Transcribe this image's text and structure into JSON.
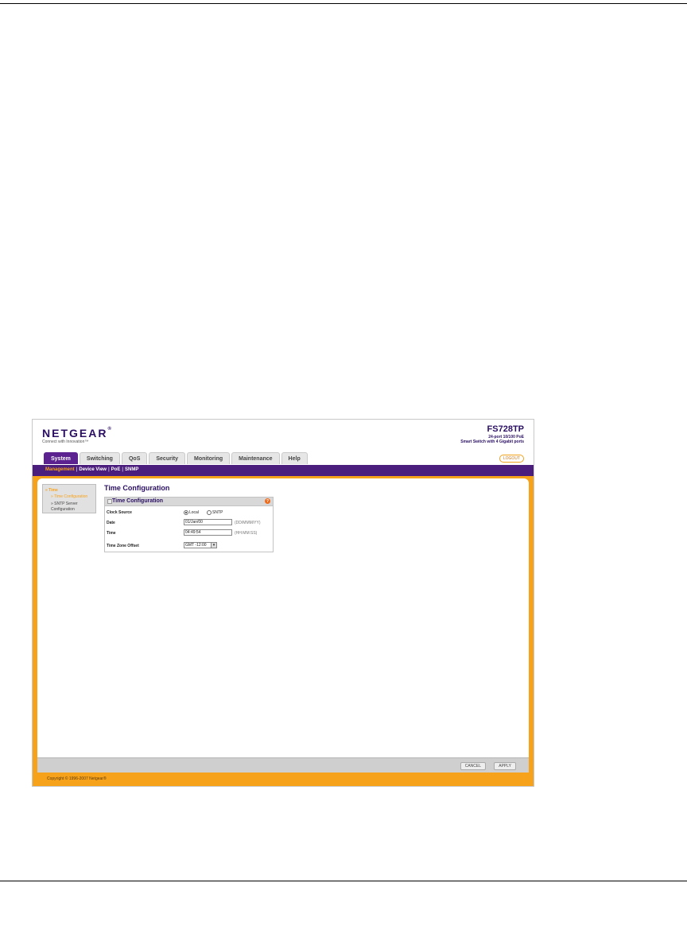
{
  "app": {
    "brand": "NETGEAR",
    "brand_mark": "®",
    "tagline": "Connect with Innovation™",
    "model": "FS728TP",
    "model_desc_1": "24-port 10/100 PoE",
    "model_desc_2": "Smart Switch with 4 Gigabit ports",
    "logout": "LOGOUT"
  },
  "tabs": [
    {
      "label": "System",
      "active": true
    },
    {
      "label": "Switching"
    },
    {
      "label": "QoS"
    },
    {
      "label": "Security"
    },
    {
      "label": "Monitoring"
    },
    {
      "label": "Maintenance"
    },
    {
      "label": "Help"
    }
  ],
  "subnav": [
    {
      "label": "Management",
      "active": true
    },
    {
      "label": "Device View"
    },
    {
      "label": "PoE"
    },
    {
      "label": "SNMP"
    }
  ],
  "subnav_separator": "|",
  "leftnav": {
    "section": "» Time",
    "item_active": "» Time Configuration",
    "item_2": "» SNTP Server Configuration"
  },
  "page": {
    "title": "Time Configuration",
    "panel_title": "Time Configuration",
    "help": "?"
  },
  "form": {
    "clock_source_label": "Clock Source",
    "clock_local": "Local",
    "clock_sntp": "SNTP",
    "date_label": "Date",
    "date_value": "01/Jan/00",
    "date_hint": "(DD/MMM/YY)",
    "time_label": "Time",
    "time_value": "04:49:54",
    "time_hint": "(HH:MM:SS)",
    "tz_label": "Time Zone Offset",
    "tz_value": "GMT -12:00",
    "tz_arrow": "▾"
  },
  "buttons": {
    "cancel": "CANCEL",
    "apply": "APPLY"
  },
  "footer": {
    "copyright": "Copyright © 1996-2007 Netgear®"
  }
}
